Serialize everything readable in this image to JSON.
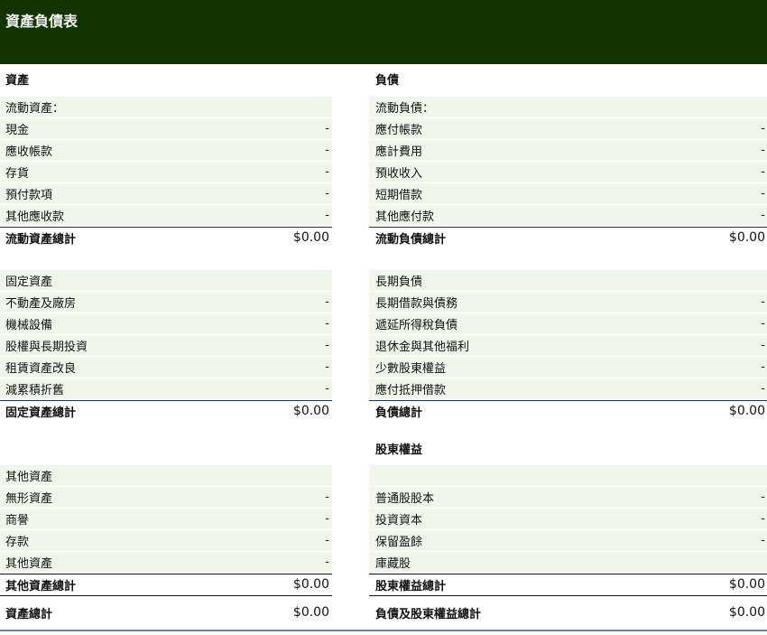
{
  "header": {
    "title": "資產負債表"
  },
  "assets": {
    "heading": "資產",
    "current": {
      "label": "流動資產：",
      "items": [
        {
          "label": "現金",
          "value": "-"
        },
        {
          "label": "應收帳款",
          "value": "-"
        },
        {
          "label": "存貨",
          "value": "-"
        },
        {
          "label": "預付款項",
          "value": "-"
        },
        {
          "label": "其他應收款",
          "value": "-"
        }
      ],
      "total_label": "流動資產總計",
      "total_value": "$0.00"
    },
    "fixed": {
      "label": "固定資產",
      "items": [
        {
          "label": "不動產及廠房",
          "value": "-"
        },
        {
          "label": "機械設備",
          "value": "-"
        },
        {
          "label": "股權與長期投資",
          "value": "-"
        },
        {
          "label": "租賃資產改良",
          "value": "-"
        },
        {
          "label": "減累積折舊",
          "value": "-"
        }
      ],
      "total_label": "固定資產總計",
      "total_value": "$0.00"
    },
    "other": {
      "label": "其他資產",
      "items": [
        {
          "label": "無形資產",
          "value": "-"
        },
        {
          "label": "商譽",
          "value": "-"
        },
        {
          "label": "存款",
          "value": "-"
        },
        {
          "label": "其他資產",
          "value": "-"
        }
      ],
      "total_label": "其他資產總計",
      "total_value": "$0.00"
    },
    "grand_total_label": "資產總計",
    "grand_total_value": "$0.00"
  },
  "liabilities": {
    "heading": "負債",
    "current": {
      "label": "流動負債：",
      "items": [
        {
          "label": "應付帳款",
          "value": "-"
        },
        {
          "label": "應計費用",
          "value": "-"
        },
        {
          "label": "預收收入",
          "value": "-"
        },
        {
          "label": "短期借款",
          "value": "-"
        },
        {
          "label": "其他應付款",
          "value": "-"
        }
      ],
      "total_label": "流動負債總計",
      "total_value": "$0.00"
    },
    "long_term": {
      "label": "長期負債",
      "items": [
        {
          "label": "長期借款與債務",
          "value": "-"
        },
        {
          "label": "遞延所得稅負債",
          "value": "-"
        },
        {
          "label": "退休金與其他福利",
          "value": "-"
        },
        {
          "label": "少數股東權益",
          "value": "-"
        },
        {
          "label": "應付抵押借款",
          "value": "-"
        }
      ],
      "total_label": "負債總計",
      "total_value": "$0.00"
    }
  },
  "equity": {
    "heading": "股東權益",
    "items": [
      {
        "label": "普通股股本",
        "value": "-"
      },
      {
        "label": "投資資本",
        "value": "-"
      },
      {
        "label": "保留盈餘",
        "value": "-"
      },
      {
        "label": "庫藏股",
        "value": ""
      }
    ],
    "total_label": "股東權益總計",
    "total_value": "$0.00",
    "grand_total_label": "負債及股東權益總計",
    "grand_total_value": "$0.00"
  }
}
